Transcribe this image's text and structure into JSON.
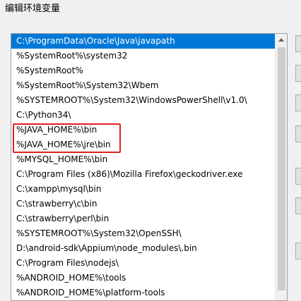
{
  "window": {
    "title": "编辑环境变量"
  },
  "path_list": {
    "selected_index": 0,
    "highlighted_entries": [
      7,
      8
    ],
    "items": [
      "C:\\ProgramData\\Oracle\\Java\\javapath",
      "%SystemRoot%\\system32",
      "%SystemRoot%",
      "%SystemRoot%\\System32\\Wbem",
      "%SYSTEMROOT%\\System32\\WindowsPowerShell\\v1.0\\",
      "C:\\Python34\\",
      "%JAVA_HOME%\\bin",
      "%JAVA_HOME%\\jre\\bin",
      "%MYSQL_HOME%\\bin",
      "C:\\Program Files (x86)\\Mozilla Firefox\\geckodriver.exe",
      "C:\\xampp\\mysql\\bin",
      "C:\\strawberry\\c\\bin",
      "C:\\strawberry\\perl\\bin",
      "%SYSTEMROOT%\\System32\\OpenSSH\\",
      "D:\\android-sdk\\Appium\\node_modules\\.bin",
      "C:\\Program Files\\nodejs\\",
      "%ANDROID_HOME%\\tools",
      "%ANDROID_HOME%\\platform-tools"
    ]
  },
  "annotation": {
    "color": "#e02020"
  },
  "colors": {
    "selection": "#0078d7"
  },
  "scrollbar": {
    "icon": "scroll-up-arrow-icon"
  }
}
